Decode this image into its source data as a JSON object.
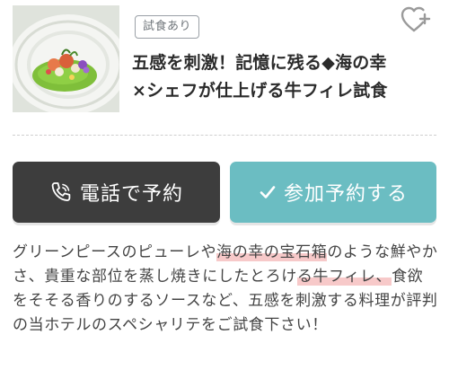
{
  "tag_label": "試食あり",
  "favorite_icon": "heart-plus-icon",
  "title": "五感を刺激！記憶に残る◆海の幸\n×シェフが仕上げる牛フィレ試食",
  "buttons": {
    "phone_label": "電話で予約",
    "phone_icon": "phone-icon",
    "reserve_label": "参加予約する",
    "reserve_icon": "check-icon"
  },
  "description": {
    "part1": "グリーンピースのピューレや",
    "highlight1": "海の幸の宝石箱",
    "part2": "のような鮮やかさ、貴重な部位を蒸し焼きにしたとろけ",
    "highlight2": "る牛フィレ、",
    "part3": "食欲をそそる香りのするソースなど、五感を刺激する料理が評判の当ホテルのスペシャリテをご試食下さい！"
  },
  "colors": {
    "phone_button": "#3d3d3d",
    "reserve_button": "#6bbdc2",
    "highlight": "#f7c9c9"
  }
}
